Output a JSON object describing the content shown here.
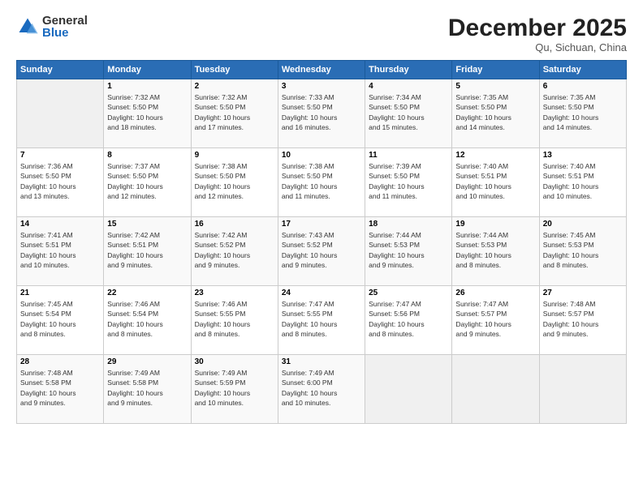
{
  "logo": {
    "general": "General",
    "blue": "Blue"
  },
  "header": {
    "month": "December 2025",
    "location": "Qu, Sichuan, China"
  },
  "days_of_week": [
    "Sunday",
    "Monday",
    "Tuesday",
    "Wednesday",
    "Thursday",
    "Friday",
    "Saturday"
  ],
  "weeks": [
    [
      {
        "day": "",
        "info": ""
      },
      {
        "day": "1",
        "info": "Sunrise: 7:32 AM\nSunset: 5:50 PM\nDaylight: 10 hours\nand 18 minutes."
      },
      {
        "day": "2",
        "info": "Sunrise: 7:32 AM\nSunset: 5:50 PM\nDaylight: 10 hours\nand 17 minutes."
      },
      {
        "day": "3",
        "info": "Sunrise: 7:33 AM\nSunset: 5:50 PM\nDaylight: 10 hours\nand 16 minutes."
      },
      {
        "day": "4",
        "info": "Sunrise: 7:34 AM\nSunset: 5:50 PM\nDaylight: 10 hours\nand 15 minutes."
      },
      {
        "day": "5",
        "info": "Sunrise: 7:35 AM\nSunset: 5:50 PM\nDaylight: 10 hours\nand 14 minutes."
      },
      {
        "day": "6",
        "info": "Sunrise: 7:35 AM\nSunset: 5:50 PM\nDaylight: 10 hours\nand 14 minutes."
      }
    ],
    [
      {
        "day": "7",
        "info": "Sunrise: 7:36 AM\nSunset: 5:50 PM\nDaylight: 10 hours\nand 13 minutes."
      },
      {
        "day": "8",
        "info": "Sunrise: 7:37 AM\nSunset: 5:50 PM\nDaylight: 10 hours\nand 12 minutes."
      },
      {
        "day": "9",
        "info": "Sunrise: 7:38 AM\nSunset: 5:50 PM\nDaylight: 10 hours\nand 12 minutes."
      },
      {
        "day": "10",
        "info": "Sunrise: 7:38 AM\nSunset: 5:50 PM\nDaylight: 10 hours\nand 11 minutes."
      },
      {
        "day": "11",
        "info": "Sunrise: 7:39 AM\nSunset: 5:50 PM\nDaylight: 10 hours\nand 11 minutes."
      },
      {
        "day": "12",
        "info": "Sunrise: 7:40 AM\nSunset: 5:51 PM\nDaylight: 10 hours\nand 10 minutes."
      },
      {
        "day": "13",
        "info": "Sunrise: 7:40 AM\nSunset: 5:51 PM\nDaylight: 10 hours\nand 10 minutes."
      }
    ],
    [
      {
        "day": "14",
        "info": "Sunrise: 7:41 AM\nSunset: 5:51 PM\nDaylight: 10 hours\nand 10 minutes."
      },
      {
        "day": "15",
        "info": "Sunrise: 7:42 AM\nSunset: 5:51 PM\nDaylight: 10 hours\nand 9 minutes."
      },
      {
        "day": "16",
        "info": "Sunrise: 7:42 AM\nSunset: 5:52 PM\nDaylight: 10 hours\nand 9 minutes."
      },
      {
        "day": "17",
        "info": "Sunrise: 7:43 AM\nSunset: 5:52 PM\nDaylight: 10 hours\nand 9 minutes."
      },
      {
        "day": "18",
        "info": "Sunrise: 7:44 AM\nSunset: 5:53 PM\nDaylight: 10 hours\nand 9 minutes."
      },
      {
        "day": "19",
        "info": "Sunrise: 7:44 AM\nSunset: 5:53 PM\nDaylight: 10 hours\nand 8 minutes."
      },
      {
        "day": "20",
        "info": "Sunrise: 7:45 AM\nSunset: 5:53 PM\nDaylight: 10 hours\nand 8 minutes."
      }
    ],
    [
      {
        "day": "21",
        "info": "Sunrise: 7:45 AM\nSunset: 5:54 PM\nDaylight: 10 hours\nand 8 minutes."
      },
      {
        "day": "22",
        "info": "Sunrise: 7:46 AM\nSunset: 5:54 PM\nDaylight: 10 hours\nand 8 minutes."
      },
      {
        "day": "23",
        "info": "Sunrise: 7:46 AM\nSunset: 5:55 PM\nDaylight: 10 hours\nand 8 minutes."
      },
      {
        "day": "24",
        "info": "Sunrise: 7:47 AM\nSunset: 5:55 PM\nDaylight: 10 hours\nand 8 minutes."
      },
      {
        "day": "25",
        "info": "Sunrise: 7:47 AM\nSunset: 5:56 PM\nDaylight: 10 hours\nand 8 minutes."
      },
      {
        "day": "26",
        "info": "Sunrise: 7:47 AM\nSunset: 5:57 PM\nDaylight: 10 hours\nand 9 minutes."
      },
      {
        "day": "27",
        "info": "Sunrise: 7:48 AM\nSunset: 5:57 PM\nDaylight: 10 hours\nand 9 minutes."
      }
    ],
    [
      {
        "day": "28",
        "info": "Sunrise: 7:48 AM\nSunset: 5:58 PM\nDaylight: 10 hours\nand 9 minutes."
      },
      {
        "day": "29",
        "info": "Sunrise: 7:49 AM\nSunset: 5:58 PM\nDaylight: 10 hours\nand 9 minutes."
      },
      {
        "day": "30",
        "info": "Sunrise: 7:49 AM\nSunset: 5:59 PM\nDaylight: 10 hours\nand 10 minutes."
      },
      {
        "day": "31",
        "info": "Sunrise: 7:49 AM\nSunset: 6:00 PM\nDaylight: 10 hours\nand 10 minutes."
      },
      {
        "day": "",
        "info": ""
      },
      {
        "day": "",
        "info": ""
      },
      {
        "day": "",
        "info": ""
      }
    ]
  ]
}
